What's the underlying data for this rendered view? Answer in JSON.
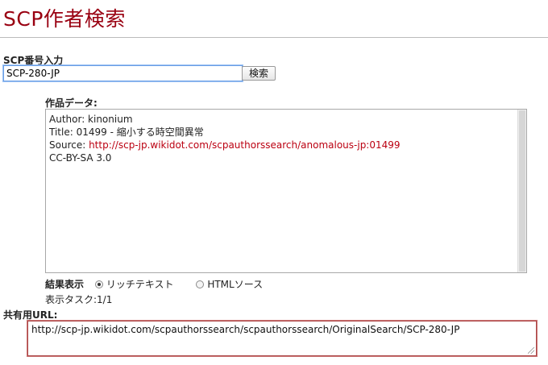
{
  "page": {
    "title": "SCP作者検索"
  },
  "search": {
    "label": "SCP番号入力",
    "value": "SCP-280-JP",
    "button_label": "検索"
  },
  "result": {
    "label": "作品データ:",
    "author_line": "Author: kinonium",
    "title_line": "Title: 01499 - 縮小する時空間異常",
    "source_prefix": "Source: ",
    "source_url": "http://scp-jp.wikidot.com/scpauthorssearch/anomalous-jp:01499",
    "license_line": "CC-BY-SA 3.0"
  },
  "display": {
    "label": "結果表示",
    "options": [
      "リッチテキスト",
      "HTMLソース"
    ],
    "selected": "リッチテキスト",
    "task_status": "表示タスク:1/1"
  },
  "share": {
    "label": "共有用URL:",
    "url": "http://scp-jp.wikidot.com/scpauthorssearch/scpauthorssearch/OriginalSearch/SCP-280-JP"
  },
  "colors": {
    "title": "#990011",
    "link": "#bb0011",
    "focus_border": "#6a9ee6",
    "share_border": "#aa4444"
  }
}
